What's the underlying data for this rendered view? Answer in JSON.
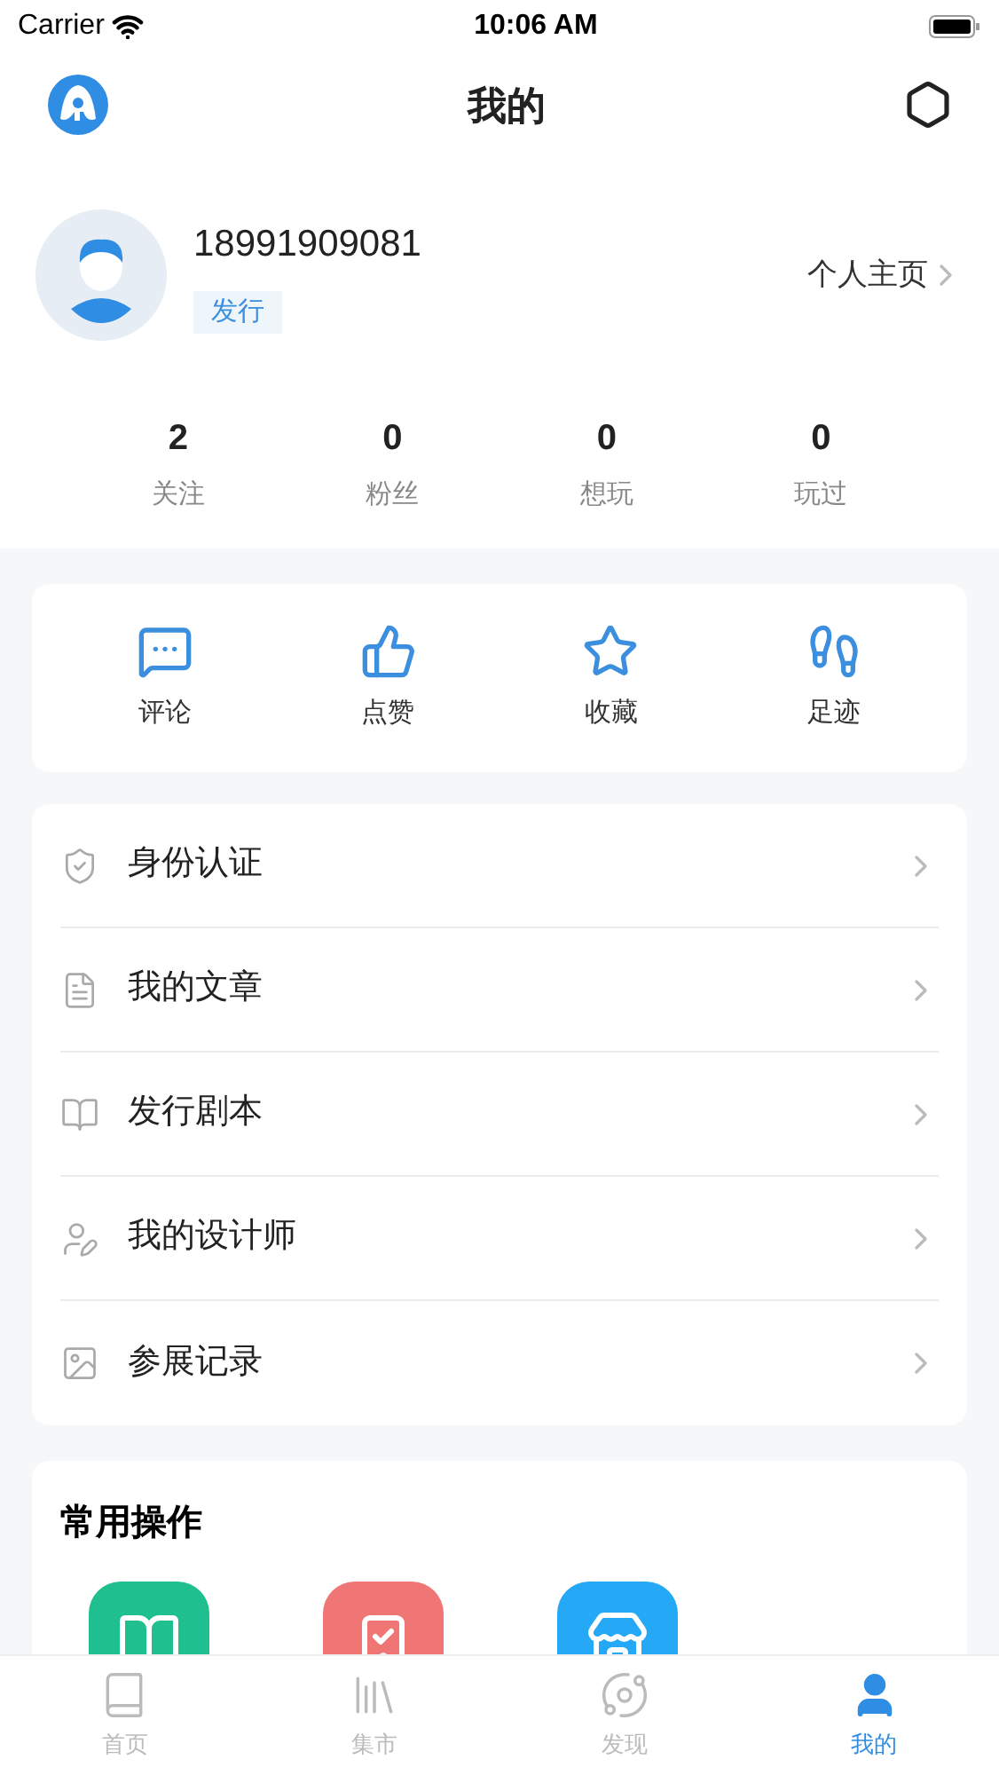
{
  "status_bar": {
    "carrier": "Carrier",
    "time": "10:06 AM"
  },
  "nav": {
    "title": "我的"
  },
  "profile": {
    "name": "18991909081",
    "tag": "发行",
    "link": "个人主页"
  },
  "stats": [
    {
      "value": "2",
      "label": "关注"
    },
    {
      "value": "0",
      "label": "粉丝"
    },
    {
      "value": "0",
      "label": "想玩"
    },
    {
      "value": "0",
      "label": "玩过"
    }
  ],
  "actions": [
    {
      "kind": "comment",
      "label": "评论"
    },
    {
      "kind": "like",
      "label": "点赞"
    },
    {
      "kind": "favorite",
      "label": "收藏"
    },
    {
      "kind": "footprint",
      "label": "足迹"
    }
  ],
  "menu": [
    {
      "kind": "shield",
      "label": "身份认证"
    },
    {
      "kind": "article",
      "label": "我的文章"
    },
    {
      "kind": "book",
      "label": "发行剧本"
    },
    {
      "kind": "designer",
      "label": "我的设计师"
    },
    {
      "kind": "image",
      "label": "参展记录"
    }
  ],
  "common_ops": {
    "title": "常用操作",
    "items": [
      {
        "kind": "book",
        "color": "#1fbf8f"
      },
      {
        "kind": "bookmark",
        "color": "#f07575"
      },
      {
        "kind": "store",
        "color": "#25a8f5"
      }
    ]
  },
  "tab_bar": [
    {
      "kind": "home",
      "label": "首页",
      "selected": false
    },
    {
      "kind": "market",
      "label": "集市",
      "selected": false
    },
    {
      "kind": "discover",
      "label": "发现",
      "selected": false
    },
    {
      "kind": "mine",
      "label": "我的",
      "selected": true
    }
  ]
}
